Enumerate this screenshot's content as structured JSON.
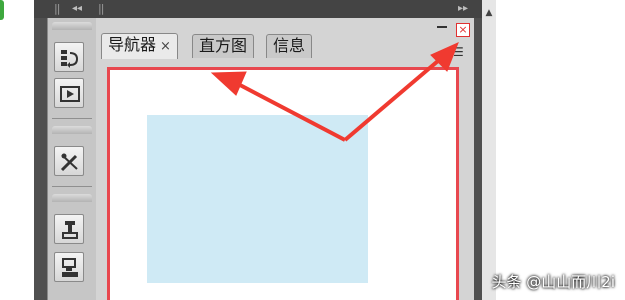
{
  "panel": {
    "tabs": [
      {
        "label": "导航器",
        "close": "×"
      },
      {
        "label": "直方图"
      },
      {
        "label": "信息"
      }
    ],
    "close_glyph": "×",
    "menu_glyph": "▾☰"
  },
  "topbar": {
    "collapse_glyph": "◂◂",
    "expand_glyph": "▸▸"
  },
  "toolbar": {
    "tools": [
      "history-tool",
      "actions-play-tool",
      "brush-tool",
      "clone-source-tool",
      "tool-presets-tool"
    ]
  },
  "colors": {
    "frame": "#505050",
    "toolbar": "#c6c6c6",
    "panel": "#d4d4d4",
    "highlight_border": "#e8484f",
    "view_box": "#cfeaf5",
    "annotation_arrow": "#f03a30"
  },
  "watermark": "头条 @山山而川2i"
}
